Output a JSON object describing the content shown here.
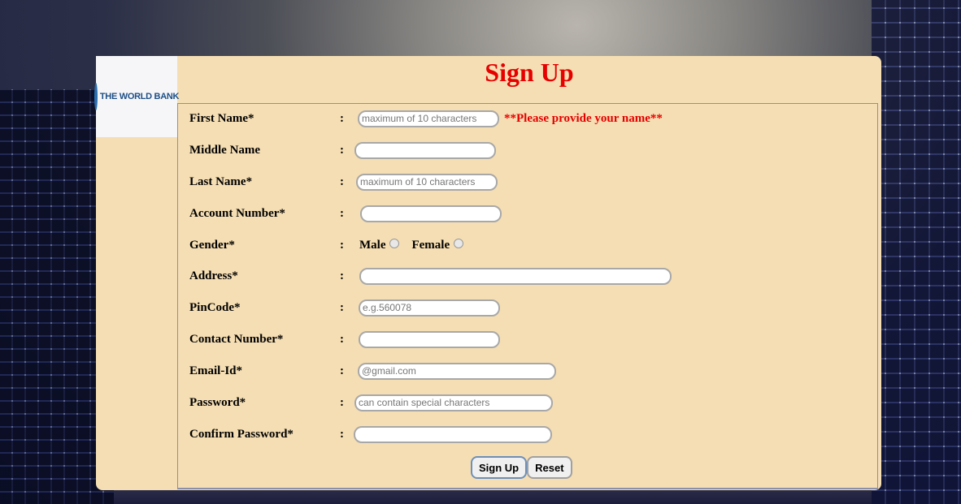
{
  "logo": {
    "text": "THE WORLD BANK",
    "icon": "globe-icon"
  },
  "title": "Sign Up",
  "fields": [
    {
      "label": "First Name*",
      "colon": ":",
      "value": "",
      "placeholder": "maximum of 10 characters",
      "error": "**Please provide your name**"
    },
    {
      "label": "Middle Name",
      "colon": ":",
      "value": "",
      "placeholder": ""
    },
    {
      "label": "Last Name*",
      "colon": ":",
      "value": "",
      "placeholder": "maximum of 10 characters"
    },
    {
      "label": "Account Number*",
      "colon": ":",
      "value": "",
      "placeholder": ""
    },
    {
      "label": "Gender*",
      "colon": ":",
      "options": [
        "Male",
        "Female"
      ]
    },
    {
      "label": "Address*",
      "colon": ":",
      "value": "",
      "placeholder": ""
    },
    {
      "label": "PinCode*",
      "colon": ":",
      "value": "",
      "placeholder": "e.g.560078"
    },
    {
      "label": "Contact Number*",
      "colon": ":",
      "value": "",
      "placeholder": ""
    },
    {
      "label": "Email-Id*",
      "colon": ":",
      "value": "",
      "placeholder": "@gmail.com"
    },
    {
      "label": "Password*",
      "colon": ":",
      "value": "",
      "placeholder": "can contain special characters"
    },
    {
      "label": "Confirm Password*",
      "colon": ":",
      "value": "",
      "placeholder": ""
    }
  ],
  "buttons": {
    "submit": "Sign Up",
    "reset": "Reset"
  },
  "colors": {
    "panel": "#f5deb3",
    "title": "#e60000",
    "error": "#e60000"
  }
}
